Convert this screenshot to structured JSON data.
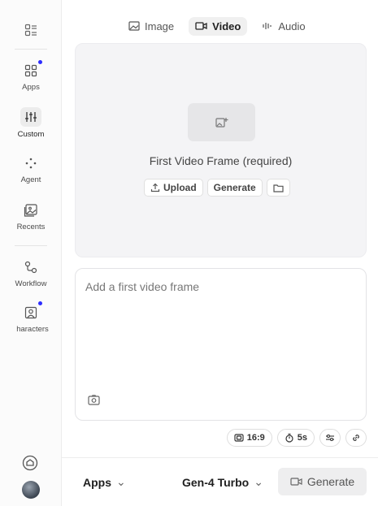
{
  "sidebar": {
    "items": [
      {
        "label": "Apps",
        "icon": "grid-icon"
      },
      {
        "label": "Custom",
        "icon": "sliders-icon"
      },
      {
        "label": "Agent",
        "icon": "sparkle-dots-icon"
      },
      {
        "label": "Recents",
        "icon": "recents-image-icon"
      },
      {
        "label": "Workflow",
        "icon": "workflow-icon"
      },
      {
        "label": "haracters",
        "icon": "characters-icon"
      }
    ]
  },
  "tabs": [
    {
      "label": "Image",
      "icon": "image-icon"
    },
    {
      "label": "Video",
      "icon": "video-icon"
    },
    {
      "label": "Audio",
      "icon": "audio-wave-icon"
    }
  ],
  "frame": {
    "title": "First Video Frame (required)",
    "upload_label": "Upload",
    "generate_label": "Generate"
  },
  "prompt": {
    "placeholder": "Add a first video frame"
  },
  "settings": {
    "aspect": "16:9",
    "duration": "5s"
  },
  "bottom": {
    "apps_label": "Apps",
    "model_label": "Gen-4 Turbo",
    "generate_label": "Generate"
  },
  "colors": {
    "accent_dot": "#2d2dff",
    "panel_bg": "#f4f4f6"
  }
}
